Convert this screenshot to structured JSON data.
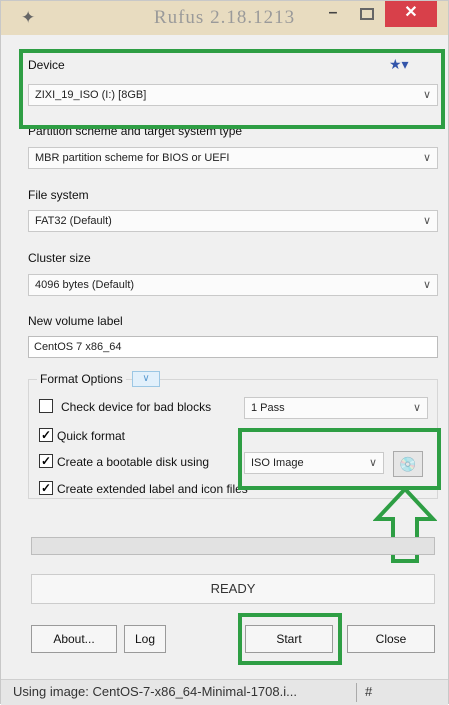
{
  "window": {
    "title": "Rufus 2.18.1213",
    "minimize_icon": "minimize-icon",
    "maximize_icon": "maximize-icon",
    "close_icon": "close-icon",
    "close_color": "#d8404a"
  },
  "device": {
    "label": "Device",
    "value": "ZIXI_19_ISO (I:) [8GB]"
  },
  "partition": {
    "label": "Partition scheme and target system type",
    "value": "MBR partition scheme for BIOS or UEFI"
  },
  "filesystem": {
    "label": "File system",
    "value": "FAT32 (Default)"
  },
  "cluster": {
    "label": "Cluster size",
    "value": "4096 bytes (Default)"
  },
  "volume": {
    "label": "New volume label",
    "value": "CentOS 7 x86_64"
  },
  "format_options": {
    "label": "Format Options",
    "bad_blocks_label": "Check device for bad blocks",
    "bad_blocks_checked": false,
    "passes_value": "1 Pass",
    "quick_format_label": "Quick format",
    "quick_format_checked": true,
    "bootable_label": "Create a bootable disk using",
    "bootable_checked": true,
    "bootable_value": "ISO Image",
    "extended_label": "Create extended label and icon files",
    "extended_checked": true
  },
  "progress": {
    "fraction": 0.0
  },
  "status": {
    "text": "READY"
  },
  "buttons": {
    "about": "About...",
    "log": "Log",
    "start": "Start",
    "close": "Close"
  },
  "statusbar": {
    "text": "Using image: CentOS-7-x86_64-Minimal-1708.i...",
    "hash": "#"
  },
  "colors": {
    "highlight": "#2e9e44",
    "accent": "#3355aa"
  }
}
